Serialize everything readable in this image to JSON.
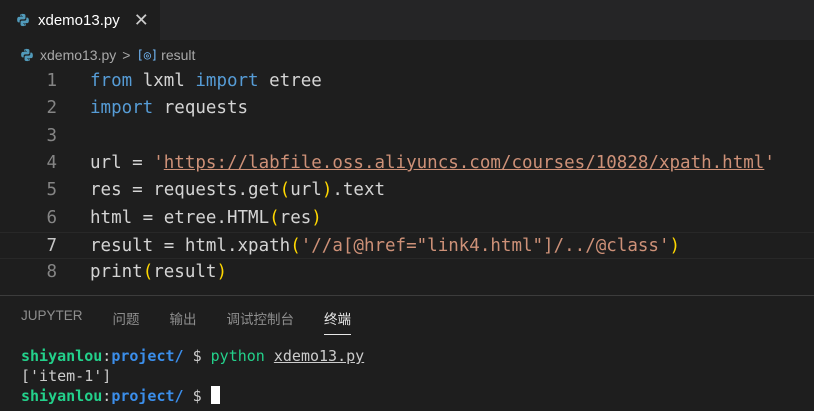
{
  "tab": {
    "filename": "xdemo13.py",
    "close_glyph": "✕"
  },
  "breadcrumb": {
    "file": "xdemo13.py",
    "separator": ">",
    "symbol_glyph": "[◎]",
    "symbol": "result"
  },
  "editor": {
    "active_line": 7,
    "lines": [
      {
        "num": "1",
        "tokens": [
          [
            "kw",
            "from"
          ],
          [
            "pl",
            " lxml "
          ],
          [
            "kw",
            "import"
          ],
          [
            "pl",
            " etree"
          ]
        ]
      },
      {
        "num": "2",
        "tokens": [
          [
            "kw",
            "import"
          ],
          [
            "pl",
            " requests"
          ]
        ]
      },
      {
        "num": "3",
        "tokens": []
      },
      {
        "num": "4",
        "tokens": [
          [
            "pl",
            "url = "
          ],
          [
            "str",
            "'"
          ],
          [
            "url",
            "https://labfile.oss.aliyuncs.com/courses/10828/xpath.html"
          ],
          [
            "str",
            "'"
          ]
        ]
      },
      {
        "num": "5",
        "tokens": [
          [
            "pl",
            "res = requests.get"
          ],
          [
            "p1",
            "("
          ],
          [
            "pl",
            "url"
          ],
          [
            "p1",
            ")"
          ],
          [
            "pl",
            ".text"
          ]
        ]
      },
      {
        "num": "6",
        "tokens": [
          [
            "pl",
            "html = etree.HTML"
          ],
          [
            "p1",
            "("
          ],
          [
            "pl",
            "res"
          ],
          [
            "p1",
            ")"
          ]
        ]
      },
      {
        "num": "7",
        "tokens": [
          [
            "pl",
            "result = html.xpath"
          ],
          [
            "p1",
            "("
          ],
          [
            "str",
            "'//a[@href=\"link4.html\"]/../@class'"
          ],
          [
            "p1",
            ")"
          ]
        ]
      },
      {
        "num": "8",
        "tokens": [
          [
            "pl",
            "print"
          ],
          [
            "p1",
            "("
          ],
          [
            "pl",
            "result"
          ],
          [
            "p1",
            ")"
          ]
        ]
      }
    ]
  },
  "panel": {
    "tabs": [
      "JUPYTER",
      "问题",
      "输出",
      "调试控制台",
      "终端"
    ],
    "active_tab": "终端"
  },
  "terminal": {
    "user": "shiyanlou",
    "colon": ":",
    "path": "project/",
    "prompt": " $ ",
    "command": "python",
    "arg": "xdemo13.py",
    "output": "['item-1']"
  },
  "colors": {
    "keyword": "#569cd6",
    "string": "#ce9178",
    "bracket": "#ffd700",
    "term_green": "#23d18b",
    "term_blue": "#3b8eea"
  }
}
